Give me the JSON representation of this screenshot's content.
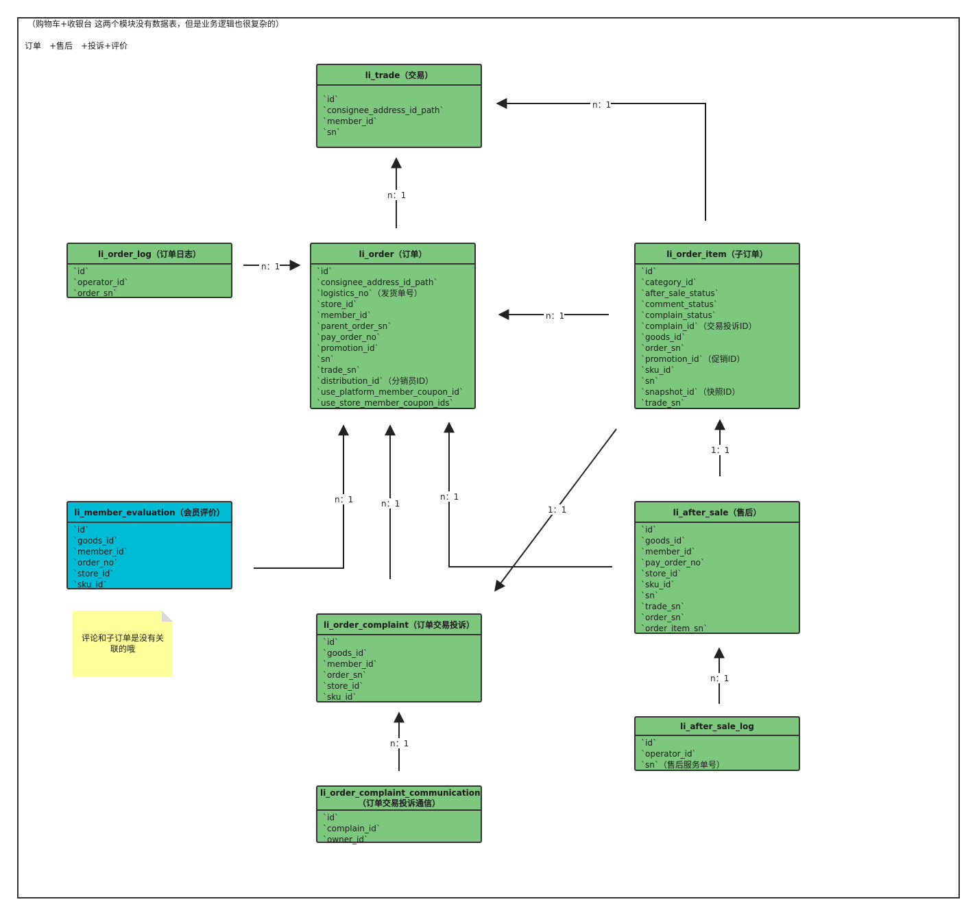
{
  "notes": {
    "line1": "（购物车+收银台 这两个模块没有数据表，但是业务逻辑也很复杂的）",
    "line2": "订单　+售后　+投诉+评价"
  },
  "sticky_note": "评论和子订单是没有关联的哦",
  "entities": {
    "trade": {
      "title": "li_trade（交易）",
      "fields": [
        "`id`",
        "`consignee_address_id_path`",
        "`member_id`",
        "`sn`"
      ]
    },
    "order_log": {
      "title": "li_order_log（订单日志）",
      "fields": [
        "`id`",
        "`operator_id`",
        "`order_sn`"
      ]
    },
    "order": {
      "title": "li_order（订单）",
      "fields": [
        "`id`",
        "`consignee_address_id_path`",
        "`logistics_no`（发货单号）",
        "`store_id`",
        "`member_id`",
        "`parent_order_sn`",
        "`pay_order_no`",
        "`promotion_id`",
        "`sn`",
        "`trade_sn`",
        "`distribution_id`（分销员ID）",
        "`use_platform_member_coupon_id`",
        "`use_store_member_coupon_ids`"
      ]
    },
    "order_item": {
      "title": "li_order_item（子订单）",
      "fields": [
        "`id`",
        "`category_id`",
        "`after_sale_status`",
        "`comment_status`",
        "`complain_status`",
        "`complain_id`（交易投诉ID）",
        "`goods_id`",
        "`order_sn`",
        "`promotion_id`（促销ID）",
        "`sku_id`",
        "`sn`",
        "`snapshot_id`（快照ID）",
        "`trade_sn`"
      ]
    },
    "member_evaluation": {
      "title": "li_member_evaluation（会员评价）",
      "fields": [
        "`id`",
        "`goods_id`",
        "`member_id`",
        "`order_no`",
        "`store_id`",
        "`sku_id`"
      ]
    },
    "after_sale": {
      "title": "li_after_sale（售后）",
      "fields": [
        "`id`",
        "`goods_id`",
        "`member_id`",
        "`pay_order_no`",
        "`store_id`",
        "`sku_id`",
        "`sn`",
        "`trade_sn`",
        "`order_sn`",
        "`order_item_sn`"
      ]
    },
    "order_complaint": {
      "title": "li_order_complaint（订单交易投诉）",
      "fields": [
        "`id`",
        "`goods_id`",
        "`member_id`",
        "`order_sn`",
        "`store_id`",
        "`sku_id`"
      ]
    },
    "after_sale_log": {
      "title": "li_after_sale_log",
      "fields": [
        "`id`",
        "`operator_id`",
        "`sn`（售后服务单号）"
      ]
    },
    "complaint_communication": {
      "title": "li_order_complaint_communication（订单交易投诉通信）",
      "fields": [
        "`id`",
        "`complain_id`",
        "`owner_id`"
      ]
    }
  },
  "relations": {
    "item_to_trade": "n：1",
    "order_to_trade": "n：1",
    "log_to_order": "n：1",
    "item_to_order": "n：1",
    "evaluation_to_order": "n：1",
    "complaint_to_order": "n：1",
    "aftersale_to_order": "n：1",
    "item_to_complaint": "1：1",
    "aftersale_to_item": "1：1",
    "aftersalelog_to_aftersale": "n：1",
    "communication_to_complaint": "n：1"
  },
  "colors": {
    "entity_green": "#7ec77f",
    "entity_blue": "#00bcd4",
    "note_yellow": "#ffff99",
    "border": "#333333"
  }
}
